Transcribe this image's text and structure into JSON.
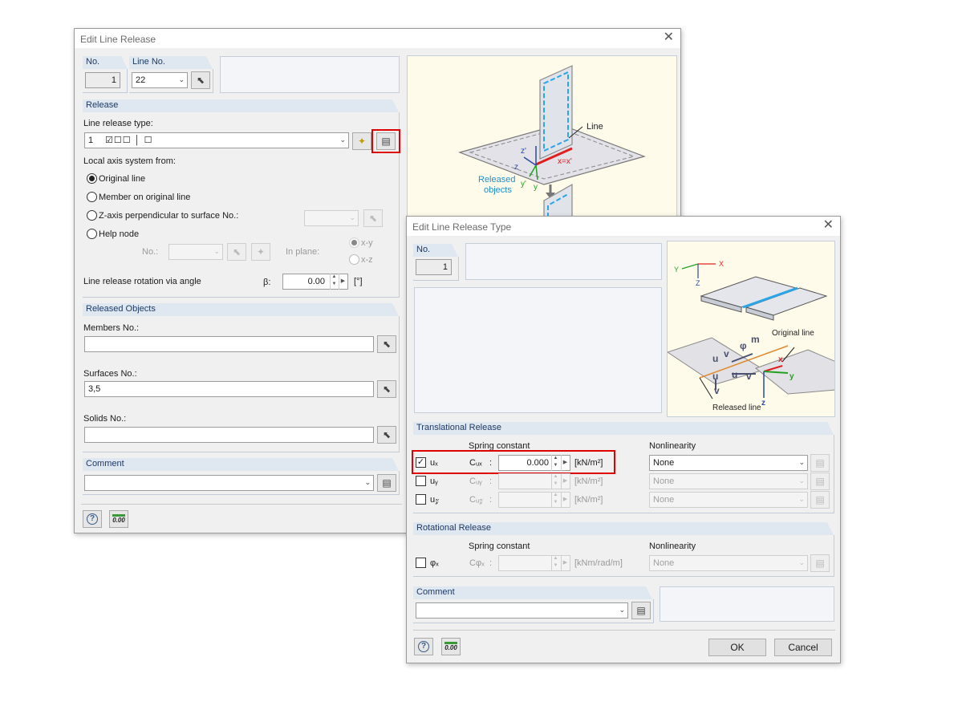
{
  "dlg1": {
    "title": "Edit Line Release",
    "close": "✕",
    "no_label": "No.",
    "no_value": "1",
    "lineno_label": "Line No.",
    "lineno_value": "22",
    "release_head": "Release",
    "release_type_label": "Line release type:",
    "release_type_value": "1",
    "local_axis_label": "Local axis system from:",
    "radio_original": "Original line",
    "radio_member": "Member on original line",
    "radio_zaxis": "Z-axis perpendicular to surface No.:",
    "radio_helpnode": "Help node",
    "helpnode_no_label": "No.:",
    "inplane_label": "In plane:",
    "plane_xy": "x-y",
    "plane_xz": "x-z",
    "rotation_label": "Line release rotation via angle",
    "beta_label": "β:",
    "beta_value": "0.00",
    "beta_unit": "[°]",
    "released_head": "Released Objects",
    "members_label": "Members No.:",
    "members_value": "",
    "surfaces_label": "Surfaces No.:",
    "surfaces_value": "3,5",
    "solids_label": "Solids No.:",
    "solids_value": "",
    "comment_head": "Comment",
    "comment_value": "",
    "units_icon_text": "0.00",
    "illu_line": "Line",
    "illu_released1": "Released",
    "illu_released2": "objects",
    "illu_z_prime": "z'",
    "illu_z": "z",
    "illu_y_prime": "y'",
    "illu_y": "y",
    "illu_x": "x=x'"
  },
  "dlg2": {
    "title": "Edit Line Release Type",
    "close": "✕",
    "no_label": "No.",
    "no_value": "1",
    "trans_head": "Translational Release",
    "spring_label": "Spring constant",
    "nonlin_label": "Nonlinearity",
    "rows": [
      {
        "sym": "uₓ",
        "c": "Cᵤₓ",
        "colon": ":",
        "value": "0.000",
        "unit": "[kN/m²]",
        "nonlin": "None"
      },
      {
        "sym": "uᵧ",
        "c": "Cᵤᵧ",
        "colon": ":",
        "value": "",
        "unit": "[kN/m²]",
        "nonlin": "None"
      },
      {
        "sym": "u𝓏",
        "c": "Cᵤ𝓏",
        "colon": ":",
        "value": "",
        "unit": "[kN/m²]",
        "nonlin": "None"
      }
    ],
    "rot_head": "Rotational Release",
    "rot_spring_label": "Spring constant",
    "rot_nonlin_label": "Nonlinearity",
    "rot_row": {
      "sym": "φₓ",
      "c": "Cφₓ",
      "colon": ":",
      "value": "",
      "unit": "[kNm/rad/m]",
      "nonlin": "None"
    },
    "comment_head": "Comment",
    "comment_value": "",
    "ok": "OK",
    "cancel": "Cancel",
    "units_icon_text": "0.00",
    "illu_original": "Original line",
    "illu_released": "Released line",
    "axis_x": "X",
    "axis_y": "Y",
    "axis_z": "Z",
    "lbl_ux": "u",
    "lbl_vx": "v",
    "lbl_phix": "φ",
    "lbl_mx": "m",
    "lbl_uy": "u",
    "lbl_vy": "v",
    "lbl_uz": "u",
    "lbl_vz": "v",
    "lbl_x": "x",
    "lbl_y": "y",
    "lbl_z": "z"
  },
  "colors": {
    "section_bg": "#dfe7f1",
    "section_text": "#1f3a62",
    "highlight": "#e00000",
    "illustration_bg": "#fffbea"
  }
}
